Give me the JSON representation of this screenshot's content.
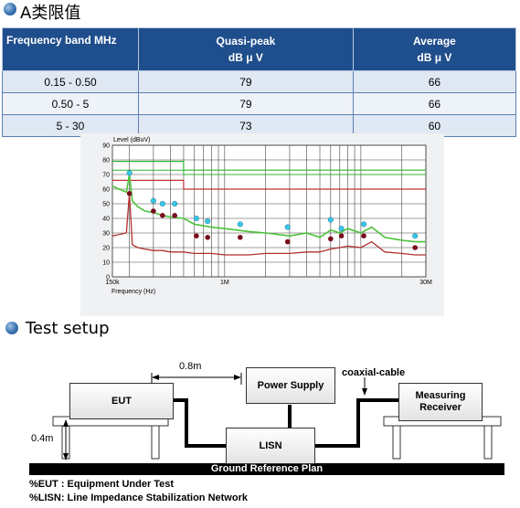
{
  "section1": {
    "title": "A类限值"
  },
  "limits_table": {
    "headers": [
      "Frequency band MHz",
      "Quasi-peak",
      "Average"
    ],
    "unit": "dB μ V",
    "rows": [
      [
        "0.15 - 0.50",
        "79",
        "66"
      ],
      [
        "0.50 - 5",
        "79",
        "66"
      ],
      [
        "5 - 30",
        "73",
        "60"
      ]
    ]
  },
  "chart_data": {
    "type": "line",
    "ylabel": "Level (dBuV)",
    "xlabel": "Frequency (Hz)",
    "x_scale": "log",
    "xlim": [
      0.15,
      30
    ],
    "ylim": [
      0,
      90
    ],
    "y_ticks": [
      "0",
      "10",
      "20",
      "30",
      "40",
      "50",
      "60",
      "70",
      "80",
      "90"
    ],
    "x_ticks": [
      "150k",
      "1M",
      "30M"
    ],
    "grid": true,
    "colors": {
      "qp_limit": "#2fb52f",
      "avg_limit": "#c03030",
      "qp_trace": "#4cc23a",
      "avg_trace": "#b23030",
      "qp_marker": "#37c7e8",
      "avg_marker": "#7a0b1e"
    },
    "series": [
      {
        "values_x": [
          0.15,
          0.5,
          0.5,
          30
        ],
        "values_y": [
          79,
          79,
          73,
          73
        ]
      },
      {
        "values_x": [
          0.15,
          0.5,
          0.5,
          30
        ],
        "values_y": [
          66,
          66,
          60,
          60
        ]
      },
      {
        "values_x": [
          0.15,
          0.5,
          0.5,
          30
        ],
        "values_y": [
          73,
          73,
          70,
          70
        ]
      },
      {
        "values_x": [
          0.15,
          0.19,
          0.2,
          0.21,
          0.23,
          0.26,
          0.3,
          0.35,
          0.4,
          0.5,
          0.6,
          0.8,
          1.0,
          1.5,
          2,
          3,
          4,
          5,
          6,
          7,
          8,
          10,
          12,
          15,
          20,
          25,
          30
        ],
        "values_y": [
          62,
          58,
          70,
          52,
          48,
          45,
          44,
          42,
          41,
          40,
          36,
          34,
          33,
          31,
          30,
          28,
          30,
          27,
          32,
          30,
          33,
          30,
          34,
          27,
          25,
          24,
          24
        ]
      },
      {
        "values_x": [
          0.15,
          0.19,
          0.2,
          0.21,
          0.23,
          0.26,
          0.3,
          0.35,
          0.4,
          0.5,
          0.6,
          0.8,
          1.0,
          1.5,
          2,
          3,
          4,
          5,
          6,
          7,
          8,
          10,
          12,
          15,
          20,
          25,
          30
        ],
        "values_y": [
          28,
          30,
          57,
          22,
          20,
          19,
          18,
          18,
          17,
          17,
          16,
          16,
          15,
          15,
          16,
          16,
          17,
          17,
          19,
          20,
          21,
          20,
          24,
          17,
          16,
          15,
          15
        ]
      }
    ],
    "qp_markers": [
      {
        "x": 0.2,
        "y": 71
      },
      {
        "x": 0.3,
        "y": 52
      },
      {
        "x": 0.35,
        "y": 50
      },
      {
        "x": 0.43,
        "y": 50
      },
      {
        "x": 0.62,
        "y": 40
      },
      {
        "x": 0.75,
        "y": 38
      },
      {
        "x": 1.3,
        "y": 36
      },
      {
        "x": 2.9,
        "y": 34
      },
      {
        "x": 6.0,
        "y": 39
      },
      {
        "x": 7.2,
        "y": 33
      },
      {
        "x": 10.5,
        "y": 36
      },
      {
        "x": 25,
        "y": 28
      }
    ],
    "avg_markers": [
      {
        "x": 0.2,
        "y": 57
      },
      {
        "x": 0.3,
        "y": 45
      },
      {
        "x": 0.35,
        "y": 42
      },
      {
        "x": 0.43,
        "y": 42
      },
      {
        "x": 0.62,
        "y": 28
      },
      {
        "x": 0.75,
        "y": 27
      },
      {
        "x": 1.3,
        "y": 27
      },
      {
        "x": 2.9,
        "y": 24
      },
      {
        "x": 6.0,
        "y": 26
      },
      {
        "x": 7.2,
        "y": 28
      },
      {
        "x": 10.5,
        "y": 28
      },
      {
        "x": 25,
        "y": 20
      }
    ]
  },
  "section2": {
    "title": "Test setup"
  },
  "setup": {
    "eut": "EUT",
    "power_supply": "Power Supply",
    "lisn": "LISN",
    "receiver_line1": "Measuring",
    "receiver_line2": "Receiver",
    "coax_label": "coaxial-cable",
    "distance_label": "0.8m",
    "height_label": "0.4m",
    "ground_label": "Ground Reference Plan",
    "note1": "%EUT : Equipment Under Test",
    "note2": "%LISN: Line Impedance Stabilization Network"
  }
}
